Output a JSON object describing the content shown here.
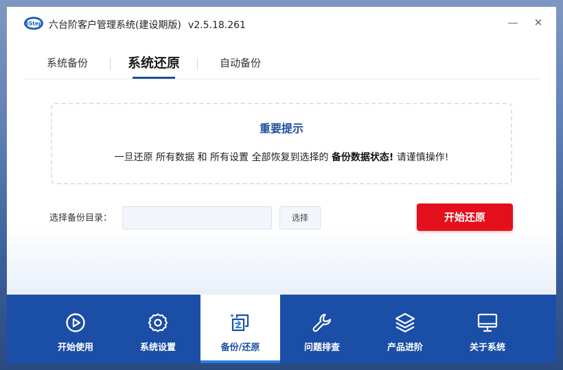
{
  "app": {
    "title": "六台阶客户管理系统(建设期版)",
    "version": "v2.5.18.261",
    "logo_text": "6Step"
  },
  "window_controls": {
    "minimize": "—",
    "close": "✕"
  },
  "tabs": [
    {
      "label": "系统备份",
      "active": false
    },
    {
      "label": "系统还原",
      "active": true
    },
    {
      "label": "自动备份",
      "active": false
    }
  ],
  "notice": {
    "title": "重要提示",
    "text_before": "一旦还原 所有数据 和 所有设置 全部恢复到选择的 ",
    "text_bold": "备份数据状态!",
    "text_after": " 请谨慎操作!"
  },
  "restore": {
    "dir_label": "选择备份目录：",
    "dir_value": "",
    "dir_placeholder": "",
    "choose_label": "选择",
    "start_label": "开始还原"
  },
  "bottom_nav": [
    {
      "label": "开始使用",
      "icon": "play-icon",
      "active": false
    },
    {
      "label": "系统设置",
      "icon": "gear-icon",
      "active": false
    },
    {
      "label": "备份/还原",
      "icon": "backup-restore-icon",
      "active": true
    },
    {
      "label": "问题排查",
      "icon": "wrench-icon",
      "active": false
    },
    {
      "label": "产品进阶",
      "icon": "layers-icon",
      "active": false
    },
    {
      "label": "关于系统",
      "icon": "monitor-icon",
      "active": false
    }
  ],
  "colors": {
    "primary": "#1b4ea6",
    "accent_red": "#e30f1b",
    "notice_title": "#1d4f9b",
    "active_underline": "#2a7fe0"
  }
}
